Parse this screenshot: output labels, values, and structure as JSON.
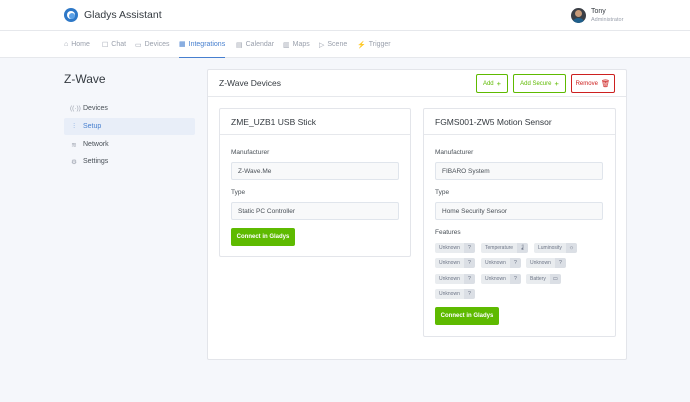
{
  "app": {
    "name": "Gladys Assistant"
  },
  "user": {
    "name": "Tony",
    "role": "Administrator"
  },
  "nav": [
    {
      "label": "Home",
      "icon": "home-icon",
      "glyph": "⌂"
    },
    {
      "label": "Chat",
      "icon": "chat-icon",
      "glyph": "☐"
    },
    {
      "label": "Devices",
      "icon": "devices-icon",
      "glyph": "▭"
    },
    {
      "label": "Integrations",
      "icon": "integrations-icon",
      "glyph": "▦"
    },
    {
      "label": "Calendar",
      "icon": "calendar-icon",
      "glyph": "▤"
    },
    {
      "label": "Maps",
      "icon": "map-icon",
      "glyph": "▥"
    },
    {
      "label": "Scene",
      "icon": "play-icon",
      "glyph": "▷"
    },
    {
      "label": "Trigger",
      "icon": "trigger-icon",
      "glyph": "⚡"
    }
  ],
  "sidebar": {
    "title": "Z-Wave",
    "items": [
      {
        "label": "Devices",
        "icon": "radio-icon",
        "glyph": "((·))"
      },
      {
        "label": "Setup",
        "icon": "sliders-icon",
        "glyph": "⫶"
      },
      {
        "label": "Network",
        "icon": "wifi-icon",
        "glyph": "≋"
      },
      {
        "label": "Settings",
        "icon": "gear-icon",
        "glyph": "⚙"
      }
    ]
  },
  "main": {
    "title": "Z-Wave Devices",
    "buttons": {
      "add": "Add",
      "add_secure": "Add Secure",
      "remove": "Remove"
    }
  },
  "labels": {
    "manufacturer": "Manufacturer",
    "type": "Type",
    "features": "Features",
    "connect": "Connect in Gladys"
  },
  "devices": [
    {
      "name": "ZME_UZB1 USB Stick",
      "manufacturer": "Z-Wave.Me",
      "type": "Static PC Controller"
    },
    {
      "name": "FGMS001-ZW5 Motion Sensor",
      "manufacturer": "FIBARO System",
      "type": "Home Security Sensor",
      "features": [
        {
          "label": "Unknown",
          "icon": "question-icon",
          "glyph": "?"
        },
        {
          "label": "Temperature",
          "icon": "thermometer-icon",
          "glyph": "🌡"
        },
        {
          "label": "Luminosity",
          "icon": "sun-icon",
          "glyph": "☼"
        },
        {
          "label": "Unknown",
          "icon": "question-icon",
          "glyph": "?"
        },
        {
          "label": "Unknown",
          "icon": "question-icon",
          "glyph": "?"
        },
        {
          "label": "Unknown",
          "icon": "question-icon",
          "glyph": "?"
        },
        {
          "label": "Unknown",
          "icon": "question-icon",
          "glyph": "?"
        },
        {
          "label": "Unknown",
          "icon": "question-icon",
          "glyph": "?"
        },
        {
          "label": "Battery",
          "icon": "battery-icon",
          "glyph": "▭"
        },
        {
          "label": "Unknown",
          "icon": "question-icon",
          "glyph": "?"
        }
      ]
    }
  ],
  "colors": {
    "accent": "#467fcf",
    "green": "#5eba00",
    "red": "#cd201f"
  }
}
